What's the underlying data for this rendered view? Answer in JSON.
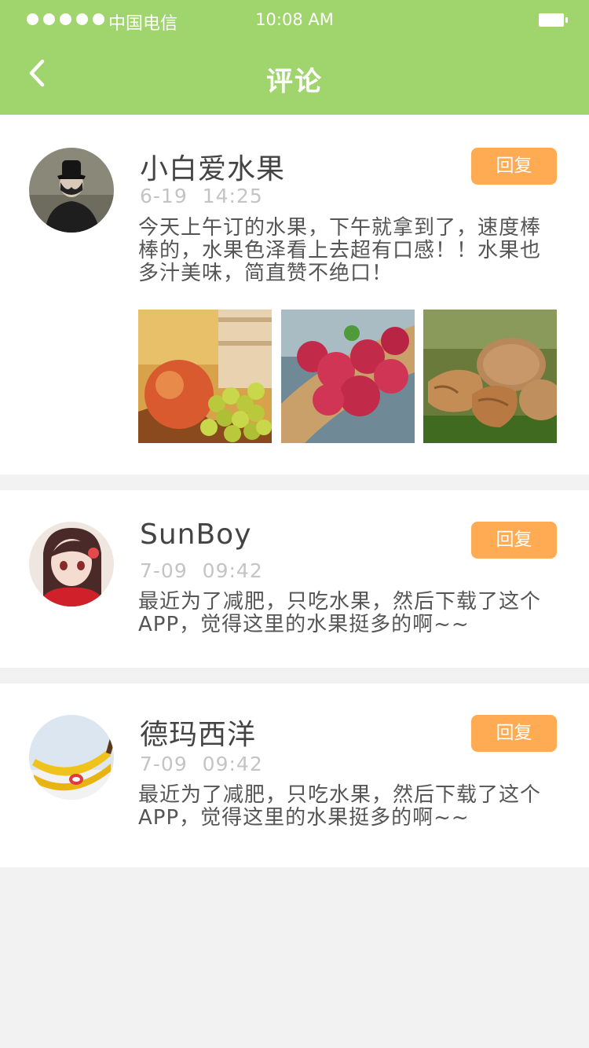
{
  "status_bar": {
    "carrier": "中国电信",
    "time": "10:08 AM"
  },
  "header": {
    "title": "评论",
    "back_icon": "chevron-left-icon"
  },
  "comments": [
    {
      "username": "小白爱水果",
      "time": "6-19 14:25",
      "reply_label": "回复",
      "text": "今天上午订的水果，下午就拿到了，速度棒棒的，水果色泽看上去超有口感！！水果也多汁美味，简直赞不绝口！",
      "photos": [
        "apple-grapes-photo",
        "raspberries-photo",
        "walnuts-photo"
      ]
    },
    {
      "username": "SunBoy",
      "time": "7-09 09:42",
      "reply_label": "回复",
      "text": "最近为了减肥，只吃水果，然后下载了这个APP，觉得这里的水果挺多的啊~~"
    },
    {
      "username": "德玛西洋",
      "time": "7-09 09:42",
      "reply_label": "回复",
      "text": "最近为了减肥，只吃水果，然后下载了这个APP，觉得这里的水果挺多的啊~~"
    }
  ],
  "colors": {
    "header_bg": "#a0d46c",
    "reply_button_bg": "#ffab54",
    "page_bg": "#f2f2f2"
  }
}
